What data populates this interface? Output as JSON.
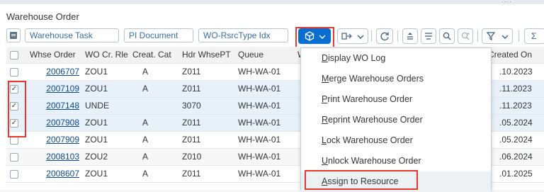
{
  "window": {
    "title": "Warehouse Order"
  },
  "toolbar": {
    "fields": [
      "Warehouse Task",
      "PI Document",
      "WO-RsrcType Idx"
    ],
    "sum_label": "Σ"
  },
  "table": {
    "columns": [
      "Whse Order",
      "WO Cr. Rle",
      "Creat. Cat",
      "Hdr WhsePT",
      "Queue",
      "W",
      "Created On"
    ],
    "rows": [
      {
        "order": "2006707",
        "rule": "ZOU1",
        "cat": "A",
        "hdr": "Z011",
        "queue": "WH-WA-01",
        "date": ".10.2023",
        "checked": false,
        "mark": ""
      },
      {
        "order": "2007109",
        "rule": "ZOU1",
        "cat": "A",
        "hdr": "Z011",
        "queue": "WH-WA-01",
        "date": ".11.2023",
        "checked": true,
        "mark": "✓"
      },
      {
        "order": "2007148",
        "rule": "UNDE",
        "cat": "",
        "hdr": "3070",
        "queue": "WH-WA-01",
        "date": ".11.2023",
        "checked": true,
        "mark": "✓"
      },
      {
        "order": "2007908",
        "rule": "ZOU1",
        "cat": "A",
        "hdr": "Z011",
        "queue": "WH-WA-01",
        "date": ".05.2024",
        "checked": true,
        "mark": "✓"
      },
      {
        "order": "2007909",
        "rule": "ZOU1",
        "cat": "A",
        "hdr": "Z011",
        "queue": "WH-WA-01",
        "date": ".05.2024",
        "checked": false,
        "mark": ""
      },
      {
        "order": "2008103",
        "rule": "ZOU2",
        "cat": "A",
        "hdr": "Z010",
        "queue": "WH-WA-01",
        "date": ".06.2024",
        "checked": false,
        "mark": ""
      },
      {
        "order": "2008607",
        "rule": "ZOU1",
        "cat": "A",
        "hdr": "Z011",
        "queue": "WH-WA-01",
        "date": ".01.2025",
        "checked": false,
        "mark": ""
      }
    ]
  },
  "menu": {
    "items": [
      "Display WO Log",
      "Merge Warehouse Orders",
      "Print Warehouse Order",
      "Reprint Warehouse Order",
      "Lock Warehouse Order",
      "Unlock Warehouse Order",
      "Assign to Resource"
    ]
  },
  "colors": {
    "highlight": "#e6392c",
    "accent": "#0a6ed1",
    "link": "#0a4a94"
  }
}
